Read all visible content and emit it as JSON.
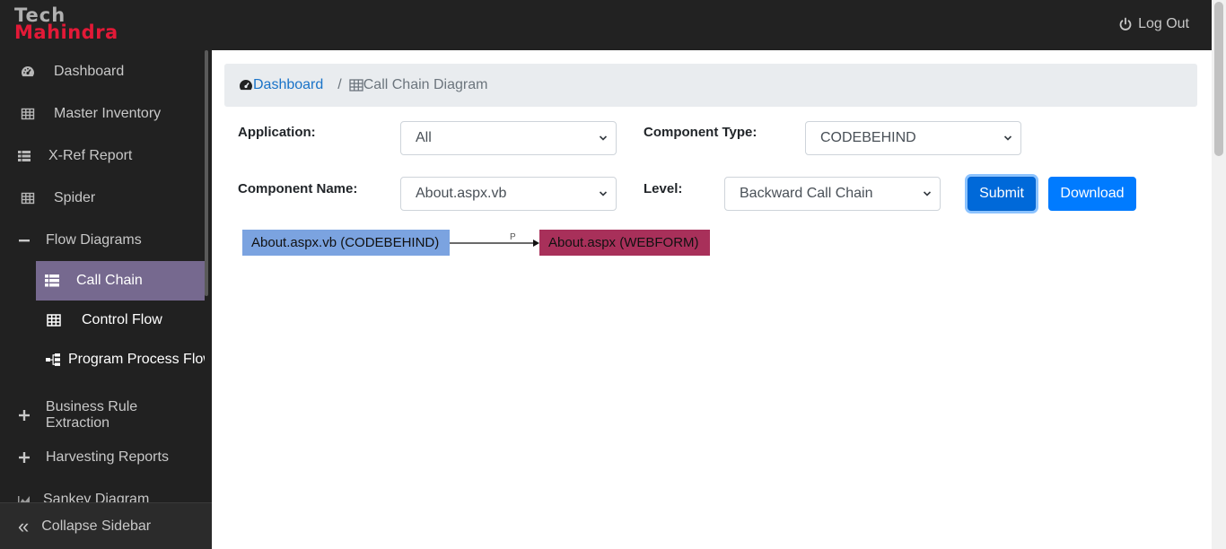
{
  "brand": {
    "line1": "Tech",
    "line2": "Mahindra"
  },
  "header": {
    "logout_label": "Log Out"
  },
  "sidebar": {
    "items": [
      {
        "label": "Dashboard",
        "icon": "dashboard-icon"
      },
      {
        "label": "Master Inventory",
        "icon": "table-icon"
      },
      {
        "label": "X-Ref Report",
        "icon": "list-icon"
      },
      {
        "label": "Spider",
        "icon": "table-icon"
      },
      {
        "label": "Flow Diagrams",
        "icon": "minus-icon"
      },
      {
        "label": "Business Rule Extraction",
        "icon": "plus-icon"
      },
      {
        "label": "Harvesting Reports",
        "icon": "plus-icon"
      },
      {
        "label": "Sankey Diagram",
        "icon": "chart-icon"
      }
    ],
    "sub_items": [
      {
        "label": "Call Chain",
        "icon": "list-icon",
        "active": true
      },
      {
        "label": "Control Flow",
        "icon": "table-icon"
      },
      {
        "label": "Program Process Flow",
        "icon": "sitemap-icon"
      }
    ],
    "collapse_label": "Collapse Sidebar"
  },
  "breadcrumb": {
    "home": "Dashboard",
    "separator": "/",
    "current": "Call Chain Diagram"
  },
  "form": {
    "application_label": "Application:",
    "application_value": "All",
    "component_type_label": "Component Type:",
    "component_type_value": "CODEBEHIND",
    "component_name_label": "Component Name:",
    "component_name_value": "About.aspx.vb",
    "level_label": "Level:",
    "level_value": "Backward Call Chain",
    "submit_label": "Submit",
    "download_label": "Download"
  },
  "diagram": {
    "source_node": "About.aspx.vb (CODEBEHIND)",
    "edge_label": "P",
    "target_node": "About.aspx (WEBFORM)",
    "source_color": "#7ba3e0",
    "target_color": "#a8305a"
  },
  "colors": {
    "accent": "#007bff",
    "active_sidebar": "#76698f",
    "brand_red": "#e31937"
  }
}
